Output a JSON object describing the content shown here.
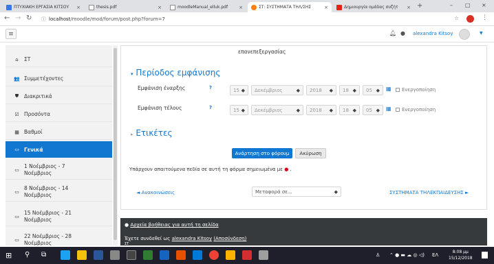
{
  "browser": {
    "tabs": [
      {
        "label": "ΠΤΥΧΙΑΚΗ ΕΡΓΑΣΙΑ ΚΙΤΣΟΥ",
        "close": "×",
        "icon_color": "#3b78e7"
      },
      {
        "label": "thesis.pdf",
        "close": "×",
        "icon_color": "#888888"
      },
      {
        "label": "moodleManual_elluk.pdf",
        "close": "×",
        "icon_color": "#888888"
      },
      {
        "label": "ΣΤ: ΣΥΣΤΗΜΑΤΑ ΤΗΛ/ΣΗΣ",
        "close": "×",
        "icon_color": "#f98012"
      },
      {
        "label": "Δημιουργία ομάδας συζήτ",
        "close": "×",
        "icon_color": "#e62117"
      }
    ],
    "new_tab": "+",
    "url_host": "localhost",
    "url_path": "/moodle/mod/forum/post.php?forum=7",
    "window_controls": [
      "–",
      "□",
      "×"
    ]
  },
  "navbar": {
    "user_name": "alexandra Kitsoy"
  },
  "sidebar": {
    "items": [
      {
        "icon": "⌂",
        "label": "ΣΤ"
      },
      {
        "icon": "👥",
        "label": "Συμμετέχοντες"
      },
      {
        "icon": "⛊",
        "label": "Διακριτικά"
      },
      {
        "icon": "☑",
        "label": "Προσόντα"
      },
      {
        "icon": "▦",
        "label": "Βαθμοί"
      },
      {
        "icon": "▭",
        "label": "Γενικά"
      },
      {
        "icon": "▭",
        "label_line1": "1 Νοέμβριος - 7",
        "label_line2": "Νοέμβριος"
      },
      {
        "icon": "▭",
        "label_line1": "8 Νοέμβριος - 14",
        "label_line2": "Νοέμβριος"
      },
      {
        "icon": "▭",
        "label_line1": "15 Νοέμβριος - 21",
        "label_line2": "Νοέμβριος"
      },
      {
        "icon": "▭",
        "label_line1": "22 Νοέμβριος - 28",
        "label_line2": "Νοέμβριος"
      }
    ]
  },
  "main": {
    "top_text": "επανεπεξεργασίας",
    "display_section": {
      "title": "Περίοδος εμφάνισης",
      "start": {
        "label": "Εμφάνιση έναρξης",
        "day": "15",
        "month": "Δεκέμβριος",
        "year": "2018",
        "hour": "18",
        "minute": "05",
        "enable": "Ενεργοποίηση"
      },
      "end": {
        "label": "Εμφάνιση τέλους",
        "day": "15",
        "month": "Δεκέμβριος",
        "year": "2018",
        "hour": "18",
        "minute": "05",
        "enable": "Ενεργοποίηση"
      }
    },
    "tags_section": {
      "title": "Ετικέτες"
    },
    "submit_label": "Ανάρτηση στο φόρουμ",
    "cancel_label": "Ακύρωση",
    "required_note": "Υπάρχουν απαιτούμενα πεδία σε αυτή τη φόρμα σημειωμένα με",
    "required_dot": ".",
    "prev_link": "◄ Ανακοινώσεις",
    "jump_placeholder": "Μεταφορά σε...",
    "next_link": "ΣΥΣΤΗΜΑΤΑ ΤΗΛΕΚΠΑΙΔΕΥΣΗΣ ►"
  },
  "footer": {
    "help_link": "Αρχεία βοήθειας για αυτή τη σελίδα",
    "logged_prefix": "Έχετε συνδεθεί ως",
    "logged_user": "alexandra Kitsoy",
    "logout": "(Αποσύνδεση)",
    "course": "ΣΤ"
  },
  "taskbar": {
    "time": "8:08 μμ",
    "date": "15/12/2018",
    "lang": "ΕΛ"
  },
  "colors": {
    "accent": "#1177d1",
    "sidebar_bg": "#f2f2f2",
    "footer_bg": "#373a3c",
    "taskbar_bg": "#1f1f2b",
    "required": "#d9001b"
  }
}
